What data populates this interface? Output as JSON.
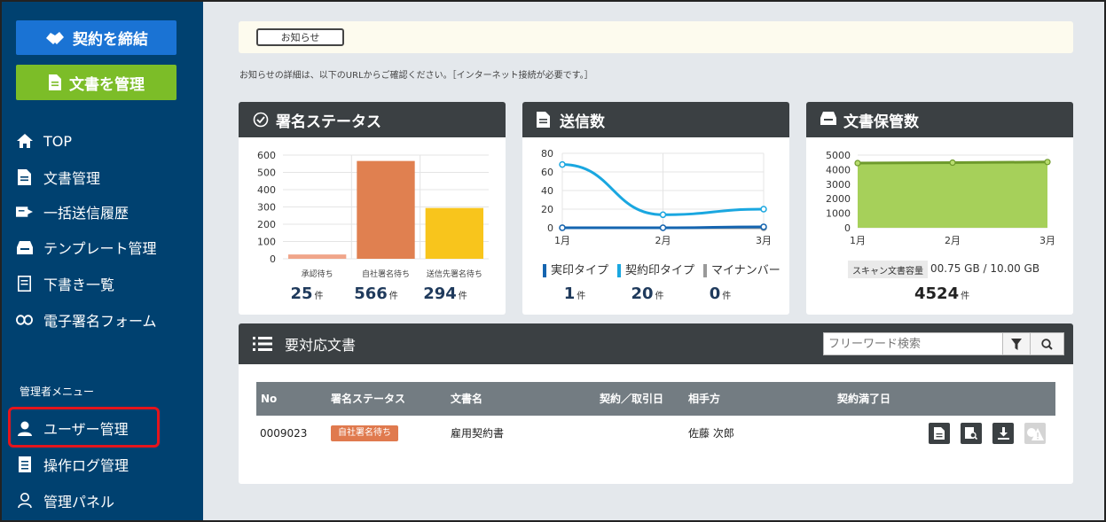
{
  "sidebar": {
    "btn_sign": "契約を締結",
    "btn_docs": "文書を管理",
    "nav": [
      {
        "label": "TOP",
        "icon": "home-icon"
      },
      {
        "label": "文書管理",
        "icon": "document-icon"
      },
      {
        "label": "一括送信履歴",
        "icon": "batch-send-icon"
      },
      {
        "label": "テンプレート管理",
        "icon": "inbox-icon"
      },
      {
        "label": "下書き一覧",
        "icon": "draft-icon"
      },
      {
        "label": "電子署名フォーム",
        "icon": "link-icon"
      }
    ],
    "admin_label": "管理者メニュー",
    "admin_nav": [
      {
        "label": "ユーザー管理",
        "icon": "user-icon"
      },
      {
        "label": "操作ログ管理",
        "icon": "log-icon"
      },
      {
        "label": "管理パネル",
        "icon": "admin-panel-icon"
      }
    ]
  },
  "notice": {
    "button": "お知らせ",
    "text": "お知らせの詳細は、以下のURLからご確認ください。［インターネット接続が必要です。］"
  },
  "cards": {
    "status": {
      "title": "署名ステータス",
      "stats": [
        {
          "value": "25",
          "unit": "件"
        },
        {
          "value": "566",
          "unit": "件"
        },
        {
          "value": "294",
          "unit": "件"
        }
      ]
    },
    "sent": {
      "title": "送信数",
      "legend": [
        "実印タイプ",
        "契約印タイプ",
        "マイナンバー"
      ],
      "stats": [
        {
          "value": "1",
          "unit": "件"
        },
        {
          "value": "20",
          "unit": "件"
        },
        {
          "value": "0",
          "unit": "件"
        }
      ]
    },
    "storage": {
      "title": "文書保管数",
      "scan_label": "スキャン文書容量",
      "scan_value": "00.75 GB / 10.00 GB",
      "count": "4524",
      "unit": "件"
    }
  },
  "tasks": {
    "title": "要対応文書",
    "search_placeholder": "フリーワード検索",
    "columns": [
      "No",
      "署名ステータス",
      "文書名",
      "契約／取引日",
      "相手方",
      "契約満了日"
    ],
    "rows": [
      {
        "no": "0009023",
        "status": "自社署名待ち",
        "name": "雇用契約書",
        "date": "",
        "party": "佐藤 次郎",
        "expiry": ""
      }
    ]
  },
  "colors": {
    "sidebar": "#004170",
    "sign_button": "#1a73d4",
    "docs_button": "#7cbd28",
    "card_header": "#3b4043",
    "highlight": "#e5141c"
  },
  "chart_data": [
    {
      "type": "bar",
      "categories": [
        "承認待ち",
        "自社署名待ち",
        "送信先署名待ち"
      ],
      "values": [
        25,
        566,
        294
      ],
      "colors": [
        "#f0a58a",
        "#e08050",
        "#f8c51c"
      ],
      "yticks": [
        "0",
        "100",
        "200",
        "300",
        "400",
        "500",
        "600"
      ],
      "ylim": [
        0,
        600
      ],
      "grid": true
    },
    {
      "type": "line",
      "categories": [
        "1月",
        "2月",
        "3月"
      ],
      "yticks": [
        "0",
        "20",
        "40",
        "60",
        "80"
      ],
      "ylim": [
        0,
        80
      ],
      "series": [
        {
          "name": "実印タイプ",
          "color": "#1565b0",
          "values": [
            0,
            0,
            1
          ]
        },
        {
          "name": "契約印タイプ",
          "color": "#1aa7e0",
          "values": [
            68,
            14,
            20
          ]
        },
        {
          "name": "マイナンバー",
          "color": "#999999",
          "values": [
            0,
            0,
            0
          ]
        }
      ],
      "grid": true
    },
    {
      "type": "area",
      "categories": [
        "1月",
        "2月",
        "3月"
      ],
      "yticks": [
        "0",
        "1000",
        "2000",
        "3000",
        "4000",
        "5000"
      ],
      "ylim": [
        0,
        5000
      ],
      "series": [
        {
          "color": "#94c947",
          "values": [
            4450,
            4480,
            4524
          ]
        }
      ],
      "grid": true
    }
  ]
}
